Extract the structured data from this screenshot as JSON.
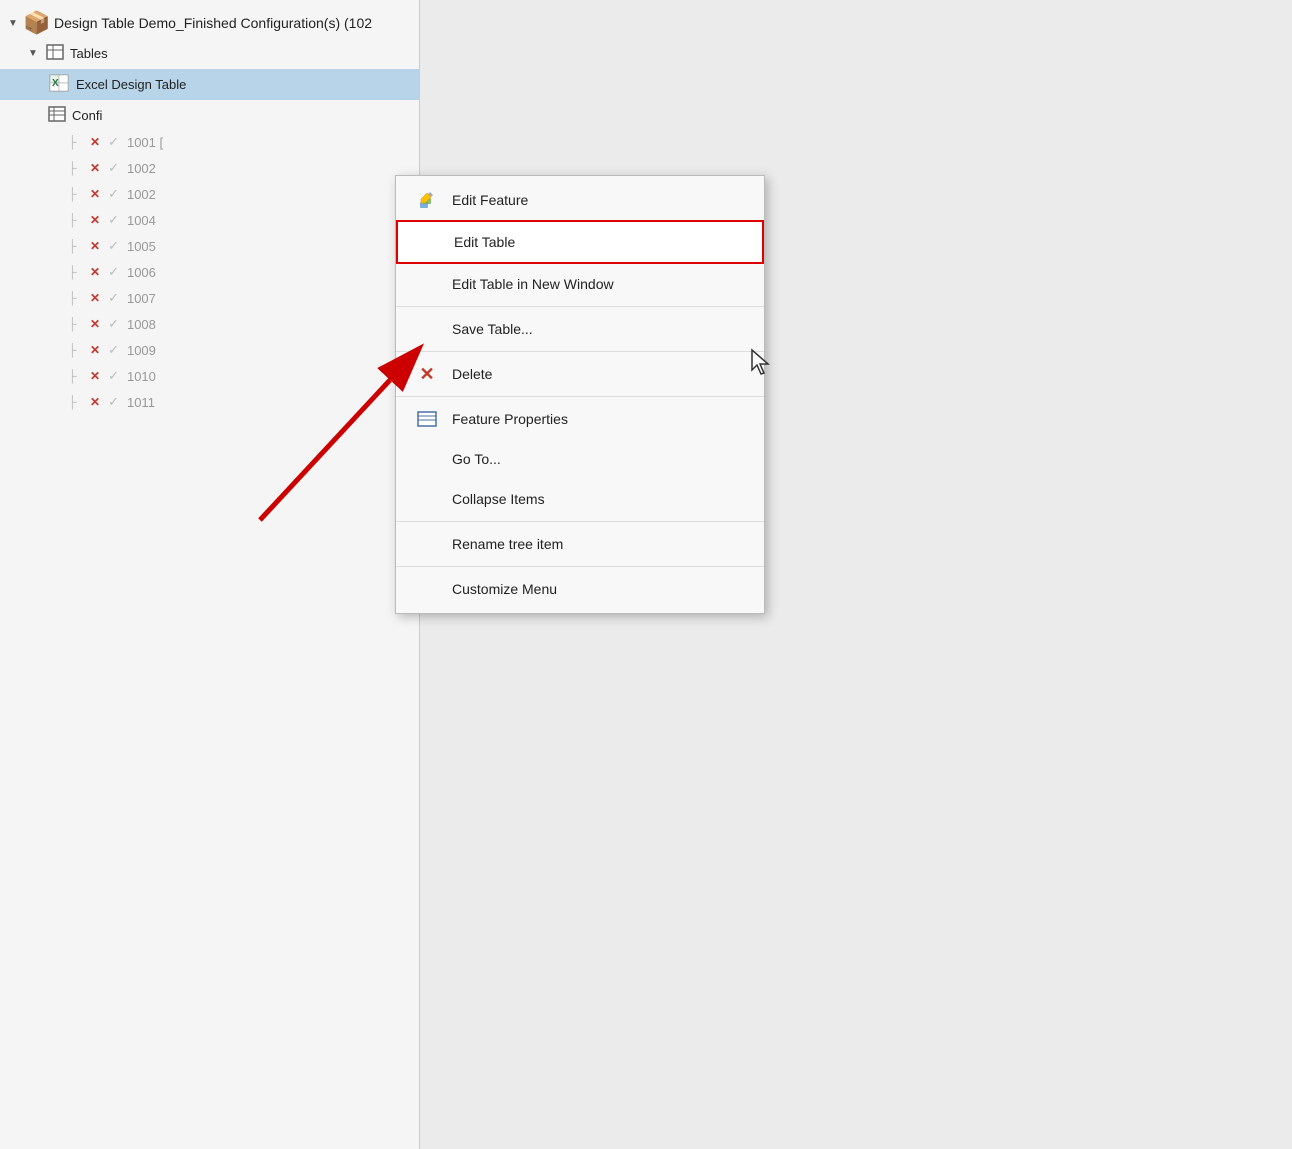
{
  "tree": {
    "root": {
      "label": "Design Table Demo_Finished Configuration(s)  (102",
      "icon": "package-icon"
    },
    "tables_node": {
      "label": "Tables",
      "icon": "tables-icon"
    },
    "excel_design_table": {
      "label": "Excel Design Table",
      "icon": "excel-icon"
    },
    "config_node": {
      "label": "Confi",
      "icon": "config-icon"
    },
    "rows": [
      {
        "num": "1001 [",
        "x": "✕",
        "check": "✓"
      },
      {
        "num": "1002",
        "x": "✕",
        "check": "✓"
      },
      {
        "num": "1002",
        "x": "✕",
        "check": "✓"
      },
      {
        "num": "1004",
        "x": "✕",
        "check": "✓"
      },
      {
        "num": "1005",
        "x": "✕",
        "check": "✓"
      },
      {
        "num": "1006",
        "x": "✕",
        "check": "✓"
      },
      {
        "num": "1007",
        "x": "✕",
        "check": "✓"
      },
      {
        "num": "1008",
        "x": "✕",
        "check": "✓"
      },
      {
        "num": "1009",
        "x": "✕",
        "check": "✓"
      },
      {
        "num": "1010",
        "x": "✕",
        "check": "✓"
      },
      {
        "num": "1011",
        "x": "✕",
        "check": "✓"
      }
    ]
  },
  "context_menu": {
    "items": [
      {
        "id": "edit-feature",
        "label": "Edit Feature",
        "icon": "edit-feature-icon",
        "separator_after": false
      },
      {
        "id": "edit-table",
        "label": "Edit Table",
        "icon": null,
        "highlighted": true,
        "separator_after": false
      },
      {
        "id": "edit-table-new-window",
        "label": "Edit Table in New Window",
        "icon": null,
        "separator_after": true
      },
      {
        "id": "save-table",
        "label": "Save Table...",
        "icon": null,
        "separator_after": true
      },
      {
        "id": "delete",
        "label": "Delete",
        "icon": "delete-icon",
        "separator_after": true
      },
      {
        "id": "feature-properties",
        "label": "Feature Properties",
        "icon": "feature-properties-icon",
        "separator_after": false
      },
      {
        "id": "go-to",
        "label": "Go To...",
        "icon": null,
        "separator_after": false
      },
      {
        "id": "collapse-items",
        "label": "Collapse Items",
        "icon": null,
        "separator_after": true
      },
      {
        "id": "rename-tree-item",
        "label": "Rename tree item",
        "icon": null,
        "separator_after": true
      },
      {
        "id": "customize-menu",
        "label": "Customize Menu",
        "icon": null,
        "separator_after": false
      }
    ]
  },
  "colors": {
    "accent_blue": "#b8d4e8",
    "selected_bg": "#cce4f7",
    "menu_highlight_border": "#dd0000",
    "tree_text": "#888888",
    "menu_bg": "#f8f8f8"
  }
}
